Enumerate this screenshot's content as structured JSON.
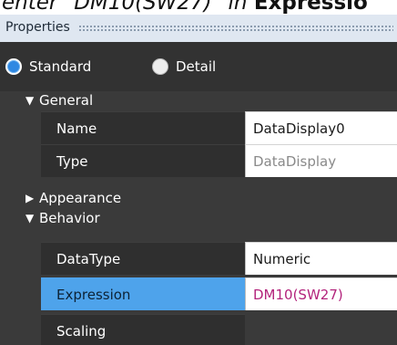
{
  "caption_fragment": {
    "text_before": "enter \"",
    "text_italic": "DM10(SW27)",
    "text_after": "\" in ",
    "text_bold": "Expressio"
  },
  "panel": {
    "title": "Properties",
    "modes": [
      {
        "label": "Standard",
        "selected": true
      },
      {
        "label": "Detail",
        "selected": false
      }
    ],
    "groups": {
      "general": {
        "label": "General",
        "expanded": true,
        "rows": [
          {
            "name": "Name",
            "value": "DataDisplay0"
          },
          {
            "name": "Type",
            "value": "DataDisplay"
          }
        ]
      },
      "appearance": {
        "label": "Appearance",
        "expanded": false
      },
      "behavior": {
        "label": "Behavior",
        "expanded": true,
        "rows": [
          {
            "name": "DataType",
            "value": "Numeric"
          },
          {
            "name": "Expression",
            "value": "DM10(SW27)"
          },
          {
            "name": "Scaling",
            "value": ""
          }
        ]
      }
    },
    "icons": {
      "expanded": "triangle-down-icon",
      "collapsed": "triangle-right-icon"
    },
    "colors": {
      "accent_selected": "#4ea3eb",
      "expression_text": "#b3247c",
      "readonly_text": "#8a8a8a"
    }
  }
}
